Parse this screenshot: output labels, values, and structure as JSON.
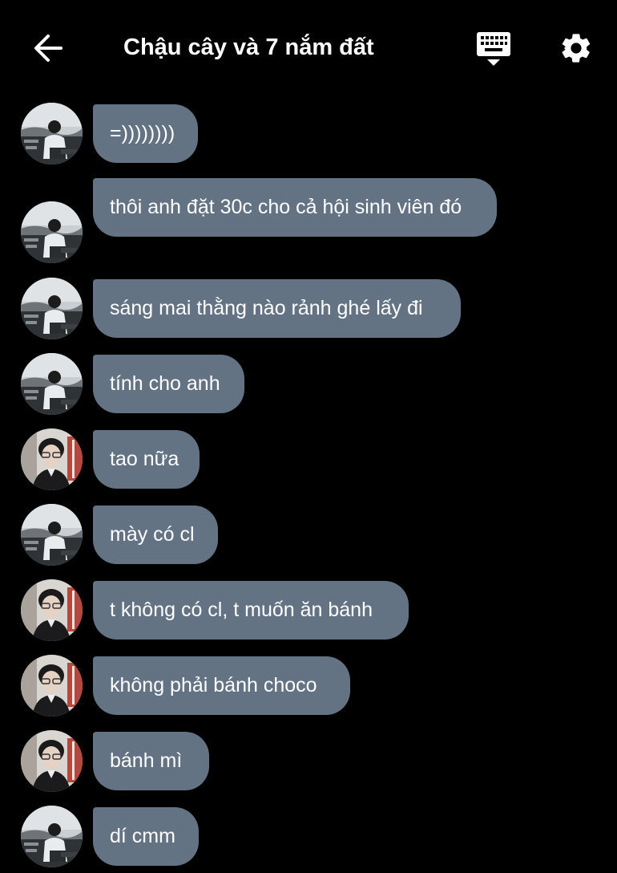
{
  "header": {
    "title": "Chậu cây và 7 nắm đất",
    "back_icon": "arrow-left-icon",
    "keyboard_icon": "keyboard-hide-icon",
    "settings_icon": "gear-icon"
  },
  "colors": {
    "background": "#000000",
    "bubble": "#647383",
    "text": "#ffffff"
  },
  "messages": [
    {
      "sender": "avatar-a",
      "text": "=))))))))"
    },
    {
      "sender": "avatar-a",
      "text": "thôi anh đặt 30c cho cả hội sinh viên đó"
    },
    {
      "sender": "avatar-a",
      "text": "sáng mai thằng nào rảnh ghé lấy đi"
    },
    {
      "sender": "avatar-a",
      "text": "tính cho anh"
    },
    {
      "sender": "avatar-b",
      "text": "tao nữa"
    },
    {
      "sender": "avatar-a",
      "text": "mày có cl"
    },
    {
      "sender": "avatar-b",
      "text": "t không có cl, t muốn ăn bánh"
    },
    {
      "sender": "avatar-b",
      "text": "không phải bánh choco"
    },
    {
      "sender": "avatar-b",
      "text": "bánh mì"
    },
    {
      "sender": "avatar-a",
      "text": "dí cmm"
    }
  ]
}
